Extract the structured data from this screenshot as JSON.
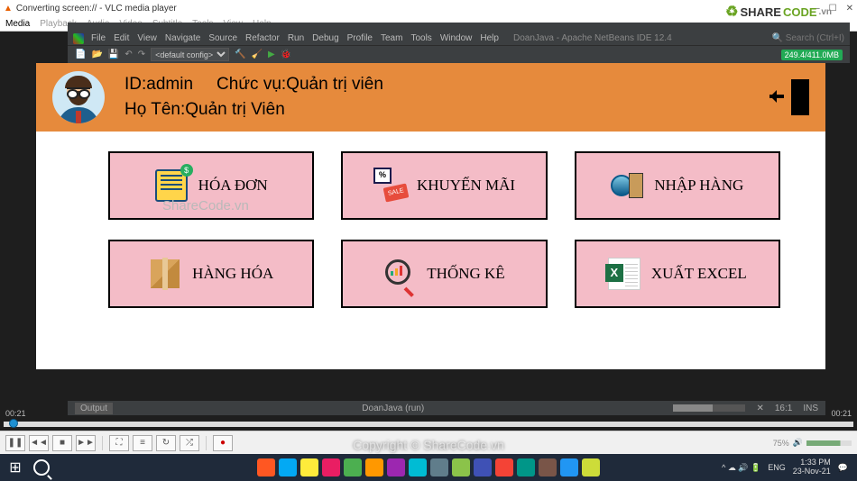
{
  "vlc": {
    "title": "Converting screen:// - VLC media player",
    "menus": [
      "Media",
      "Playback",
      "Audio",
      "Video",
      "Subtitle",
      "Tools",
      "View",
      "Help"
    ],
    "time_elapsed": "00:21",
    "time_total": "00:21",
    "volume_pct": "75%",
    "controls": {
      "play": "❚❚",
      "prev": "◄◄",
      "stop": "■",
      "next": "►►",
      "fullscreen": "⛶",
      "playlist": "≡",
      "loop": "↻",
      "shuffle": "⤮",
      "record": "●"
    }
  },
  "ide": {
    "menus": [
      "File",
      "Edit",
      "View",
      "Navigate",
      "Source",
      "Refactor",
      "Run",
      "Debug",
      "Profile",
      "Team",
      "Tools",
      "Window",
      "Help"
    ],
    "title": "DoanJava - Apache NetBeans IDE 12.4",
    "search_placeholder": "Search (Ctrl+I)",
    "config": "<default config>",
    "memory": "249.4/411.0MB",
    "output_tab": "Output",
    "run_label": "DoanJava (run)",
    "cursor": "16:1",
    "ins": "INS"
  },
  "app": {
    "id_label": "ID:admin",
    "role_label": "Chức vụ:Quản trị viên",
    "name_label": "Họ Tên:Quản trị Viên",
    "cards": {
      "invoice": "HÓA ĐƠN",
      "promo": "KHUYẾN MÃI",
      "import": "NHẬP HÀNG",
      "goods": "HÀNG HÓA",
      "stats": "THỐNG KÊ",
      "excel": "XUẤT EXCEL"
    }
  },
  "taskbar": {
    "lang": "ENG",
    "time": "1:33 PM",
    "date": "23-Nov-21",
    "tray": "^  ☁  🔊  🔋"
  },
  "watermarks": {
    "app": "ShareCode.vn",
    "page_mid": "Copyright © ShareCode.vn",
    "brand_a": "SHARE",
    "brand_b": "CODE",
    "brand_c": ".vn"
  }
}
